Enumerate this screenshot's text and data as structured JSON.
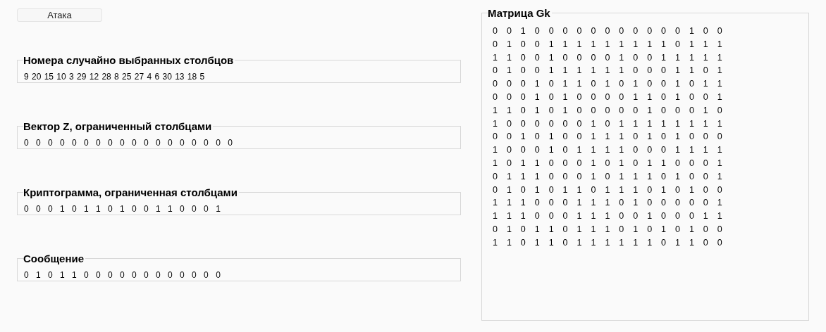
{
  "attack_button": {
    "label": "Атака"
  },
  "fields": [
    {
      "title": "Номера случайно выбранных столбцов",
      "kind": "numbers",
      "value": "9 20 15 10 3 29 12 28 8 25 27 4 6 30 13 18 5"
    },
    {
      "title": "Вектор Z, ограниченный столбцами",
      "kind": "bits",
      "value": "0 0 0 0 0 0 0 0 0 0 0 0 0 0 0 0 0 0"
    },
    {
      "title": "Криптограмма, ограниченная столбцами",
      "kind": "bits",
      "value": "0 0 0 1 0 1 1 0 1 0 0 1 1 0 0 0 1"
    },
    {
      "title": "Сообщение",
      "kind": "bits",
      "value": "0 1 0 1 1 0 0 0 0 0 0 0 0 0 0 0 0"
    }
  ],
  "matrix": {
    "title": "Матрица Gk",
    "rows": [
      "0 0 1 0 0 0 0 0 0 0 0 0 0 0 1 0 0",
      "0 1 0 0 1 1 1 1 1 1 1 1 1 0 1 1 1",
      "1 1 0 0 1 0 0 0 0 1 0 0 1 1 1 1 1",
      "0 1 0 0 1 1 1 1 1 1 0 0 0 1 1 0 1",
      "0 0 0 1 0 1 1 0 1 0 1 0 0 1 0 1 1",
      "0 0 0 1 0 1 0 0 0 0 1 1 0 1 0 0 1",
      "1 1 0 1 0 1 0 0 0 0 0 1 0 0 0 1 0",
      "1 0 0 0 0 0 0 1 0 1 1 1 1 1 1 1 1",
      "0 0 1 0 1 0 0 1 1 1 0 1 0 1 0 0 0",
      "1 0 0 0 1 0 1 1 1 1 0 0 0 1 1 1 1",
      "1 0 1 1 0 0 0 1 0 1 0 1 1 0 0 0 1",
      "0 1 1 1 0 0 0 1 0 1 1 1 0 1 0 0 1",
      "0 1 0 1 0 1 1 0 1 1 1 0 1 0 1 0 0",
      "1 1 1 0 0 0 1 1 1 0 1 0 0 0 0 0 1",
      "1 1 1 0 0 0 1 1 1 0 0 1 0 0 0 1 1",
      "0 1 0 1 1 0 1 1 1 0 1 0 1 0 1 0 0",
      "1 1 0 1 1 0 1 1 1 1 1 1 0 1 1 0 0"
    ]
  }
}
